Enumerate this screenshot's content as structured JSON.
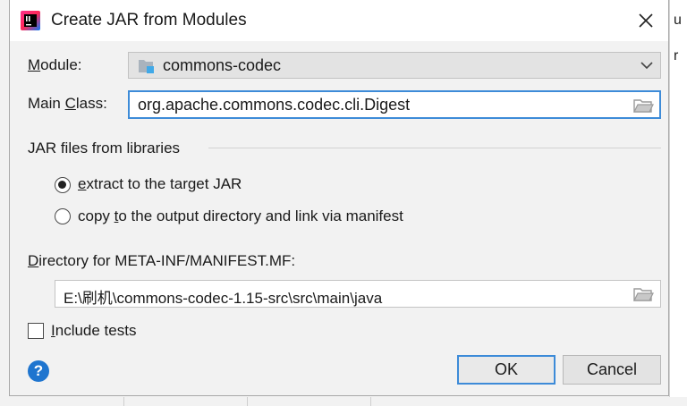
{
  "dialog": {
    "title": "Create JAR from Modules"
  },
  "module": {
    "label_mnemonic": "M",
    "label_rest": "odule:",
    "value": "commons-codec"
  },
  "main_class": {
    "label_pre": "Main ",
    "label_mnemonic": "C",
    "label_rest": "lass:",
    "value": "org.apache.commons.codec.cli.Digest"
  },
  "libraries": {
    "heading": "JAR files from libraries",
    "option_extract_mnemonic": "e",
    "option_extract_rest": "xtract to the target JAR",
    "option_extract_checked": true,
    "option_copy_pre": "copy ",
    "option_copy_mnemonic": "t",
    "option_copy_rest": "o the output directory and link via manifest",
    "option_copy_checked": false
  },
  "manifest": {
    "label_mnemonic": "D",
    "label_rest": "irectory for META-INF/MANIFEST.MF:",
    "value": "E:\\刷机\\commons-codec-1.15-src\\src\\main\\java"
  },
  "include_tests": {
    "label_mnemonic": "I",
    "label_rest": "nclude tests",
    "checked": false
  },
  "buttons": {
    "help": "?",
    "ok": "OK",
    "cancel": "Cancel"
  },
  "background_fragments": [
    "u",
    "r"
  ],
  "colors": {
    "accent": "#3d8bd8",
    "help": "#1f75cf",
    "dialog_bg": "#f2f2f2"
  }
}
